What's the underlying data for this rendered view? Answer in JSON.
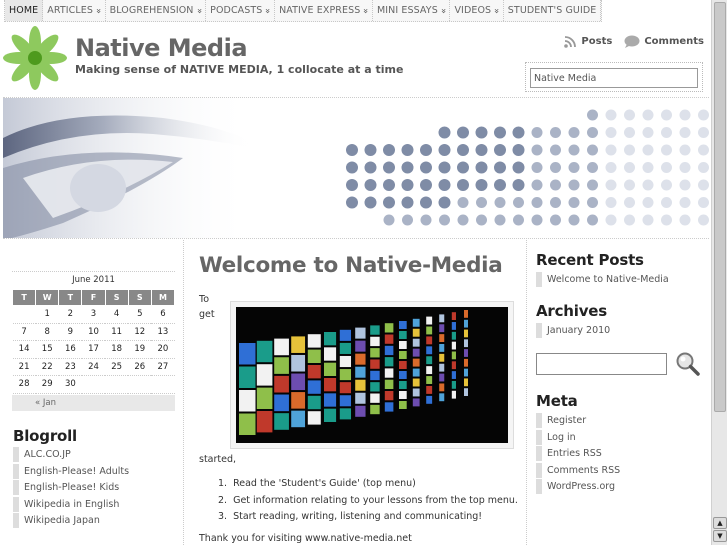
{
  "nav": {
    "items": [
      {
        "label": "HOME",
        "dropdown": false,
        "active": true
      },
      {
        "label": "ARTICLES",
        "dropdown": true
      },
      {
        "label": "BLOGREHENSION",
        "dropdown": true
      },
      {
        "label": "PODCASTS",
        "dropdown": true
      },
      {
        "label": "NATIVE EXPRESS",
        "dropdown": true
      },
      {
        "label": "MINI ESSAYS",
        "dropdown": true
      },
      {
        "label": "VIDEOS",
        "dropdown": true
      },
      {
        "label": "STUDENT'S GUIDE",
        "dropdown": false
      }
    ]
  },
  "header": {
    "title": "Native Media",
    "tagline": "Making sense of NATIVE MEDIA, 1 collocate at a time",
    "feeds": {
      "posts": "Posts",
      "comments": "Comments"
    },
    "search_value": "Native Media"
  },
  "calendar": {
    "caption": "June 2011",
    "days": [
      "T",
      "W",
      "T",
      "F",
      "S",
      "S",
      "M"
    ],
    "weeks": [
      [
        "",
        "1",
        "2",
        "3",
        "4",
        "5",
        "6"
      ],
      [
        "7",
        "8",
        "9",
        "10",
        "11",
        "12",
        "13"
      ],
      [
        "14",
        "15",
        "16",
        "17",
        "18",
        "19",
        "20"
      ],
      [
        "21",
        "22",
        "23",
        "24",
        "25",
        "26",
        "27"
      ],
      [
        "28",
        "29",
        "30",
        "",
        "",
        "",
        ""
      ]
    ],
    "prev": "« Jan"
  },
  "blogroll": {
    "title": "Blogroll",
    "links": [
      "ALC.CO.JP",
      "English-Please! Adults",
      "English-Please! Kids",
      "Wikipedia in English",
      "Wikipedia Japan"
    ]
  },
  "post": {
    "title": "Welcome to Native-Media",
    "intro_1": "To",
    "intro_2": "get",
    "intro_3": "started,",
    "steps": [
      "Read the 'Student's Guide' (top menu)",
      "Get information relating to your lessons from the top menu.",
      "Start reading, writing, listening and communicating!"
    ],
    "thanks": "Thank you for visiting www.native-media.net"
  },
  "sidebar": {
    "recent_title": "Recent Posts",
    "recent": [
      "Welcome to Native-Media"
    ],
    "archives_title": "Archives",
    "archives": [
      "January 2010"
    ],
    "meta_title": "Meta",
    "meta": [
      "Register",
      "Log in",
      "Entries RSS",
      "Comments RSS",
      "WordPress.org"
    ]
  },
  "colors": {
    "accent_green": "#5aa82a",
    "dot_dark": "#7f8ca6",
    "dot_light": "#dde1ea",
    "text_gray": "#666666"
  }
}
